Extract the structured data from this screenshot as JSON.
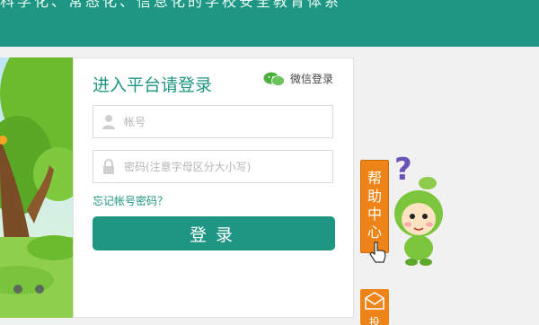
{
  "header": {
    "slogan": "科学化、常态化、信息化的学校安全教育体系"
  },
  "login": {
    "title": "进入平台请登录",
    "wechat_label": "微信登录",
    "username_placeholder": "帐号",
    "password_placeholder": "密码(注意字母区分大小写)",
    "forgot_label": "忘记帐号密码？",
    "submit_label": "登录"
  },
  "help": {
    "chars": [
      "帮",
      "助",
      "中",
      "心"
    ]
  },
  "feedback": {
    "label": "投"
  },
  "colors": {
    "brand": "#1f9583",
    "help": "#ee8418"
  }
}
